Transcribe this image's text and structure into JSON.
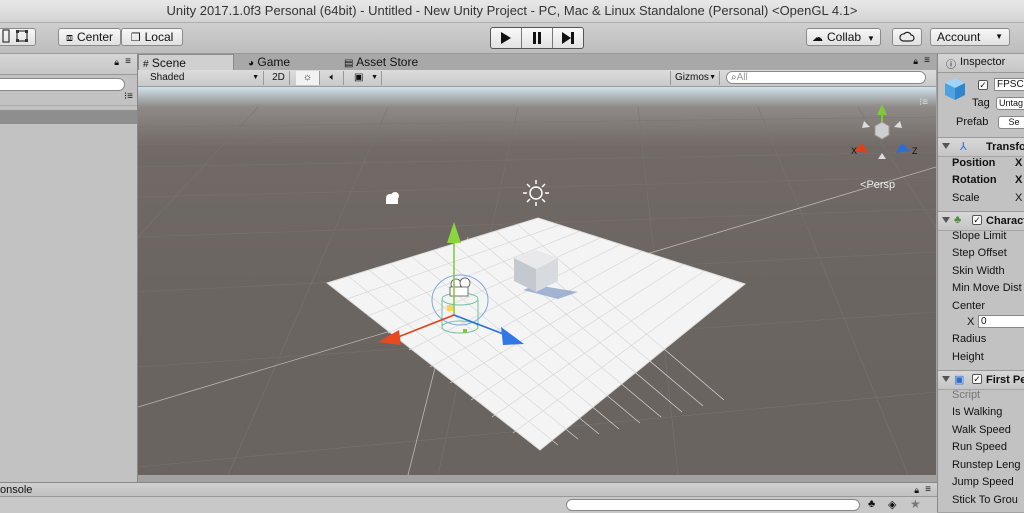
{
  "window": {
    "title": "Unity 2017.1.0f3 Personal (64bit) - Untitled - New Unity Project - PC, Mac & Linux Standalone (Personal) <OpenGL 4.1>"
  },
  "toolbar": {
    "pivot_label": "Center",
    "space_label": "Local",
    "collab_label": "Collab",
    "account_label": "Account"
  },
  "scene_tabs": {
    "scene": "Scene",
    "game": "Game",
    "asset_store": "Asset Store"
  },
  "scene_toolbar": {
    "shading_mode": "Shaded",
    "mode_2d": "2D",
    "gizmos": "Gizmos",
    "search_placeholder": "All"
  },
  "viewport": {
    "persp_label": "Persp",
    "axis_x": "X",
    "axis_z": "Z"
  },
  "inspector": {
    "tab": "Inspector",
    "object_name": "FPSC",
    "tag_label": "Tag",
    "tag_value": "Untag",
    "prefab_label": "Prefab",
    "prefab_button": "Se",
    "transform": {
      "header": "Transfo",
      "position": "Position",
      "rotation": "Rotation",
      "scale": "Scale",
      "x": "X"
    },
    "character_controller": {
      "header": "Charact",
      "slope_limit": "Slope Limit",
      "step_offset": "Step Offset",
      "skin_width": "Skin Width",
      "min_move_distance": "Min Move Dist",
      "center": "Center",
      "center_x_label": "X",
      "center_x_value": "0",
      "radius": "Radius",
      "height": "Height"
    },
    "first_person": {
      "header": "First Pe",
      "script": "Script",
      "is_walking": "Is Walking",
      "walk_speed": "Walk Speed",
      "run_speed": "Run Speed",
      "runstep_length": "Runstep Leng",
      "jump_speed": "Jump Speed",
      "stick_to_ground": "Stick To Grou"
    }
  },
  "bottom": {
    "console_tab": "onsole"
  },
  "colors": {
    "viewport_ground": "#6b6561",
    "x_axis": "#e0401a",
    "y_axis": "#7ec83a",
    "z_axis": "#2a6fd8"
  }
}
